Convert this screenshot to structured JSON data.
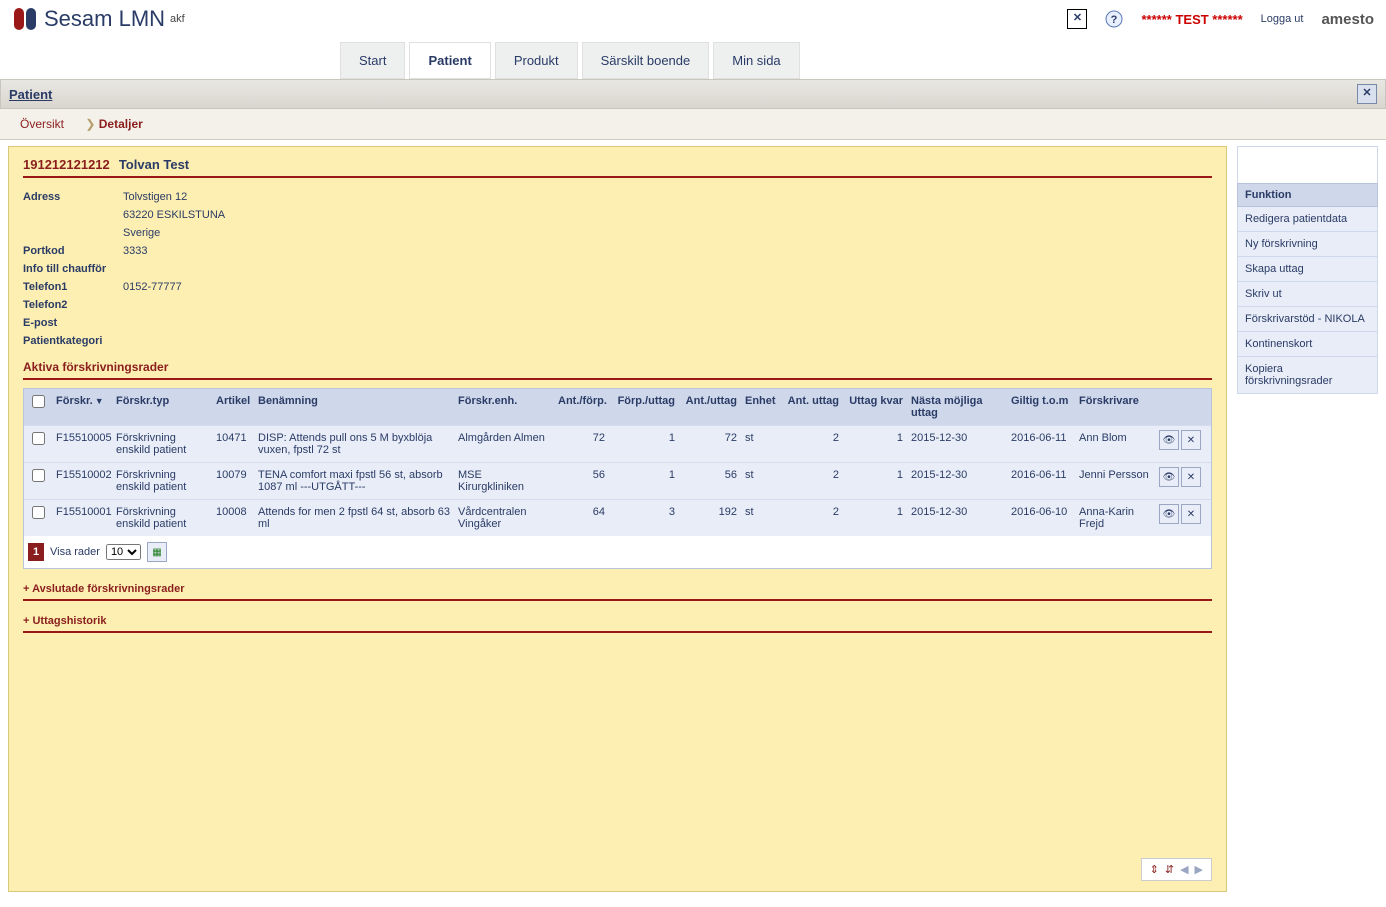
{
  "app": {
    "title": "Sesam LMN",
    "subtitle": "akf"
  },
  "header": {
    "test_banner": "****** TEST ******",
    "logout": "Logga ut",
    "brand": "amesto"
  },
  "tabs": {
    "items": [
      "Start",
      "Patient",
      "Produkt",
      "Särskilt boende",
      "Min sida"
    ],
    "active": 1
  },
  "breadcrumb": {
    "title": "Patient"
  },
  "subtabs": {
    "oversikt": "Översikt",
    "detaljer": "Detaljer",
    "active": "detaljer"
  },
  "patient": {
    "id": "191212121212",
    "name": "Tolvan Test",
    "labels": {
      "adress": "Adress",
      "portkod": "Portkod",
      "info": "Info till chaufför",
      "tel1": "Telefon1",
      "tel2": "Telefon2",
      "epost": "E-post",
      "kat": "Patientkategori"
    },
    "adress1": "Tolvstigen 12",
    "adress2": "63220 ESKILSTUNA",
    "adress3": "Sverige",
    "portkod": "3333",
    "info": "",
    "tel1": "0152-77777",
    "tel2": "",
    "epost": "",
    "kat": ""
  },
  "sections": {
    "aktiva": "Aktiva förskrivningsrader",
    "avslutade": "+ Avslutade förskrivningsrader",
    "uttag": "+ Uttagshistorik"
  },
  "grid": {
    "headers": {
      "forskr": "Förskr.",
      "ftyp": "Förskr.typ",
      "art": "Artikel",
      "ben": "Benämning",
      "fenh": "Förskr.enh.",
      "antf": "Ant./förp.",
      "fu": "Förp./uttag",
      "au": "Ant./uttag",
      "enh": "Enhet",
      "antu": "Ant. uttag",
      "uk": "Uttag kvar",
      "nast": "Nästa möjliga uttag",
      "gilt": "Giltig t.o.m",
      "skriv": "Förskrivare"
    },
    "rows": [
      {
        "forskr": "F15510005",
        "ftyp": "Förskrivning enskild patient",
        "art": "10471",
        "ben": "DISP: Attends pull ons 5 M byxblöja vuxen, fpstl 72 st",
        "fenh": "Almgården Almen",
        "antf": "72",
        "fu": "1",
        "au": "72",
        "enh": "st",
        "antu": "2",
        "uk": "1",
        "nast": "2015-12-30",
        "gilt": "2016-06-11",
        "skriv": "Ann Blom"
      },
      {
        "forskr": "F15510002",
        "ftyp": "Förskrivning enskild patient",
        "art": "10079",
        "ben": "TENA comfort maxi fpstl 56 st, absorb 1087 ml ---UTGÅTT---",
        "fenh": "MSE Kirurgkliniken",
        "antf": "56",
        "fu": "1",
        "au": "56",
        "enh": "st",
        "antu": "2",
        "uk": "1",
        "nast": "2015-12-30",
        "gilt": "2016-06-11",
        "skriv": "Jenni Persson"
      },
      {
        "forskr": "F15510001",
        "ftyp": "Förskrivning enskild patient",
        "art": "10008",
        "ben": "Attends for men 2 fpstl 64 st, absorb 63 ml",
        "fenh": "Vårdcentralen Vingåker",
        "antf": "64",
        "fu": "3",
        "au": "192",
        "enh": "st",
        "antu": "2",
        "uk": "1",
        "nast": "2015-12-30",
        "gilt": "2016-06-10",
        "skriv": "Anna-Karin Frejd"
      }
    ]
  },
  "pager": {
    "current": "1",
    "visa_label": "Visa rader",
    "options": [
      "10"
    ],
    "selected": "10"
  },
  "funktion": {
    "title": "Funktion",
    "items": [
      "Redigera patientdata",
      "Ny förskrivning",
      "Skapa uttag",
      "Skriv ut",
      "Förskrivarstöd - NIKOLA",
      "Kontinenskort",
      "Kopiera förskrivningsrader"
    ]
  }
}
